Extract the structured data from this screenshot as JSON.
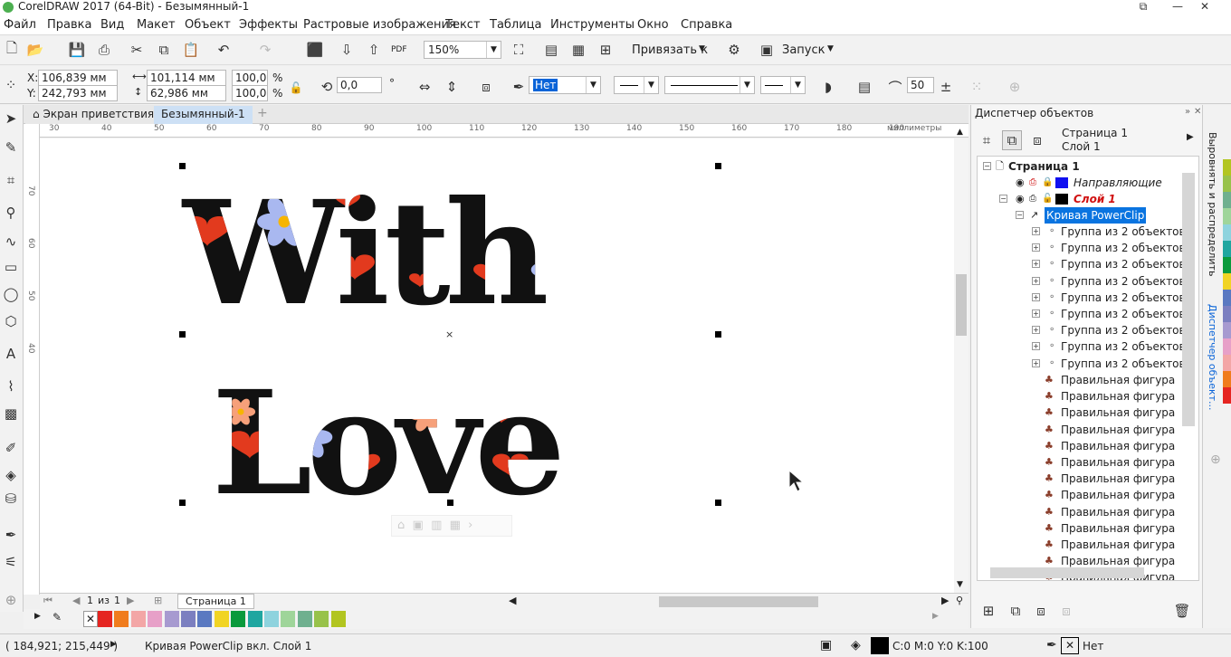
{
  "app": {
    "title": "CorelDRAW 2017 (64-Bit) - Безымянный-1"
  },
  "menu": [
    "Файл",
    "Правка",
    "Вид",
    "Макет",
    "Объект",
    "Эффекты",
    "Растровые изображения",
    "Текст",
    "Таблица",
    "Инструменты",
    "Окно",
    "Справка"
  ],
  "standard_toolbar": {
    "zoom": "150%",
    "snap_label": "Привязать к",
    "launch_label": "Запуск",
    "pdf_label": "PDF"
  },
  "property_bar": {
    "x": "106,839 мм",
    "y": "242,793 мм",
    "width": "101,114 мм",
    "height": "62,986 мм",
    "scale_x": "100,0",
    "scale_y": "100,0",
    "percent": "%",
    "rotation": "0,0",
    "degree": "°",
    "fill_value": "Нет",
    "smoothing": "50"
  },
  "doc_tabs": [
    "Экран приветствия",
    "Безымянный-1"
  ],
  "ruler": {
    "ticks": [
      "30",
      "40",
      "50",
      "60",
      "70",
      "80",
      "90",
      "100",
      "110",
      "120",
      "130",
      "140",
      "150",
      "160",
      "170",
      "180",
      "190"
    ],
    "unit": "миллиметры",
    "v_ticks": [
      "70",
      "60",
      "50",
      "40"
    ]
  },
  "artwork": {
    "line1": "With",
    "line2": "Love",
    "text_color": "#111111",
    "heart_color": "#e23a1e",
    "flower_colors": [
      "#f6a07a",
      "#a9b8f0"
    ]
  },
  "page_nav": {
    "current": "1",
    "of_label": "из",
    "total": "1",
    "page_tab": "Страница 1"
  },
  "palette": {
    "colors": [
      "#e52521",
      "#f07c1d",
      "#f3a6a6",
      "#e7a0c8",
      "#a79ad0",
      "#7b7fc0",
      "#5a79c1",
      "#f1d424",
      "#0a9a3c",
      "#1fa6a0",
      "#8ed3de",
      "#9fd59a",
      "#6fb08f",
      "#98c24a",
      "#b2c520"
    ]
  },
  "status": {
    "coords": "( 184,921; 215,449 )",
    "selection": "Кривая PowerClip вкл. Слой 1",
    "cmyk": "C:0 M:0 Y:0 K:100",
    "outline": "Нет"
  },
  "docker": {
    "title": "Диспетчер объектов",
    "page": "Страница 1",
    "layer": "Слой 1",
    "tree": {
      "page": "Страница 1",
      "guides": "Направляющие",
      "layer": "Слой 1",
      "powerclip": "Кривая PowerClip",
      "groups": [
        "Группа из 2 объектов",
        "Группа из 2 объектов",
        "Группа из 2 объектов",
        "Группа из 2 объектов",
        "Группа из 2 объектов",
        "Группа из 2 объектов",
        "Группа из 2 объектов",
        "Группа из 2 объектов",
        "Группа из 2 объектов"
      ],
      "shapes": [
        "Правильная фигура",
        "Правильная фигура",
        "Правильная фигура",
        "Правильная фигура",
        "Правильная фигура",
        "Правильная фигура",
        "Правильная фигура",
        "Правильная фигура",
        "Правильная фигура",
        "Правильная фигура",
        "Правильная фигура",
        "Правильная фигура",
        "Правильная фигура"
      ]
    }
  },
  "side_tabs": [
    "Выровнять и распределить",
    "Диспетчер объект..."
  ]
}
